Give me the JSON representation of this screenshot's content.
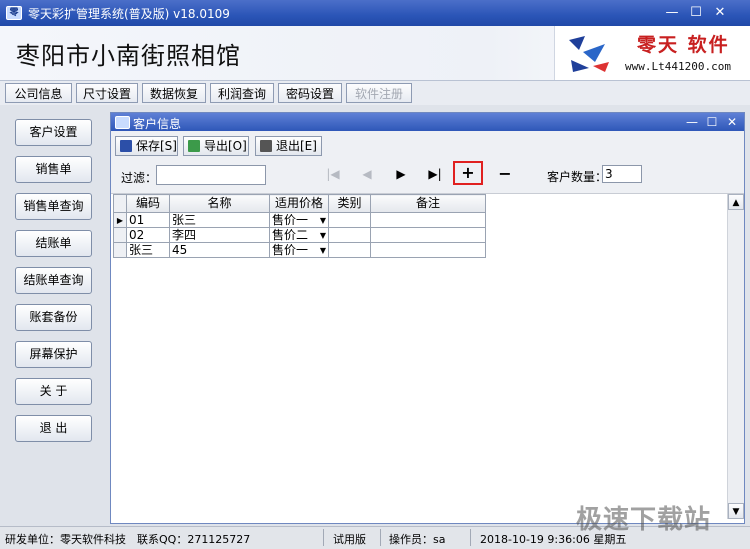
{
  "app": {
    "title": "零天彩扩管理系统(普及版)  v18.0109",
    "shop_name": "枣阳市小南街照相馆",
    "logo_brand": "零天 软件",
    "logo_site": "www.Lt441200.com"
  },
  "tabs": [
    {
      "label": "公司信息",
      "enabled": true
    },
    {
      "label": "尺寸设置",
      "enabled": true
    },
    {
      "label": "数据恢复",
      "enabled": true
    },
    {
      "label": "利润查询",
      "enabled": true
    },
    {
      "label": "密码设置",
      "enabled": true
    },
    {
      "label": "软件注册",
      "enabled": false
    }
  ],
  "nav": [
    "客户设置",
    "销售单",
    "销售单查询",
    "结账单",
    "结账单查询",
    "账套备份",
    "屏幕保护",
    "关 于",
    "退 出"
  ],
  "window": {
    "title": "客户信息",
    "toolbar": {
      "save": "保存[S]",
      "export": "导出[O]",
      "exit": "退出[E]"
    },
    "filter_label": "过滤：",
    "filter_value": "",
    "count_label": "客户数量：",
    "count_value": "3",
    "columns": [
      "编码",
      "名称",
      "适用价格",
      "类别",
      "备注"
    ],
    "rows": [
      {
        "code": "01",
        "name": "张三",
        "price": "售价一",
        "category": "",
        "note": "",
        "current": true
      },
      {
        "code": "02",
        "name": "李四",
        "price": "售价二",
        "category": "",
        "note": "",
        "current": false
      },
      {
        "code": "张三",
        "name": "45",
        "price": "售价一",
        "category": "",
        "note": "",
        "current": false
      }
    ]
  },
  "status": {
    "developer": "研发单位：零天软件科技",
    "qq": "联系QQ：271125727",
    "edition": "试用版",
    "operator": "操作员：sa",
    "datetime": "2018-10-19  9:36:06 星期五"
  },
  "watermark": "极速下载站",
  "colors": {
    "titlebar": "#2b55b7",
    "highlight_box": "#e02020",
    "brand_red": "#c82020"
  }
}
